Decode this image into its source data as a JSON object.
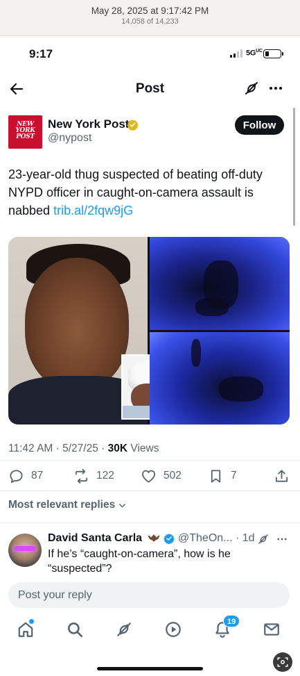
{
  "viewer": {
    "date": "May 28, 2025 at 9:17:42 PM",
    "count": "14,058 of 14,233"
  },
  "status_bar": {
    "time": "9:17",
    "network": "5G",
    "network_superscript": "UC"
  },
  "nav": {
    "title": "Post"
  },
  "author": {
    "logo_text": "NEW YORK POST",
    "name": "New York Post",
    "handle": "@nypost",
    "follow_label": "Follow"
  },
  "tweet": {
    "text": "23-year-old thug suspected of beating off-duty NYPD officer in caught-on-camera assault is nabbed",
    "link": "trib.al/2fqw9jG",
    "time": "11:42 AM",
    "date": "5/27/25",
    "views_count": "30K",
    "views_label": "Views"
  },
  "actions": {
    "replies": "87",
    "reposts": "122",
    "likes": "502",
    "bookmarks": "7"
  },
  "replies_sort": {
    "label": "Most relevant replies"
  },
  "reply": {
    "name": "David Santa Carla",
    "handle": "@TheOn...",
    "age": "1d",
    "text": "If he’s “caught-on-camera”, how is he “suspected”?"
  },
  "composer": {
    "placeholder": "Post your reply"
  },
  "tabbar": {
    "notifications_badge": "19"
  },
  "icons": {
    "back": "arrow-left-icon",
    "grok": "grok-icon",
    "more": "more-icon",
    "verified": "verified-badge-icon",
    "reply": "reply-icon",
    "repost": "repost-icon",
    "like": "heart-icon",
    "bookmark": "bookmark-icon",
    "share": "share-icon",
    "home": "home-icon",
    "search": "search-icon",
    "video": "play-icon",
    "notifications": "bell-icon",
    "messages": "mail-icon"
  },
  "colors": {
    "accent": "#1d9bf0",
    "verified_gold": "#e2b719",
    "nypost_red": "#c8102e",
    "text_primary": "#0f1419",
    "text_secondary": "#536471"
  }
}
